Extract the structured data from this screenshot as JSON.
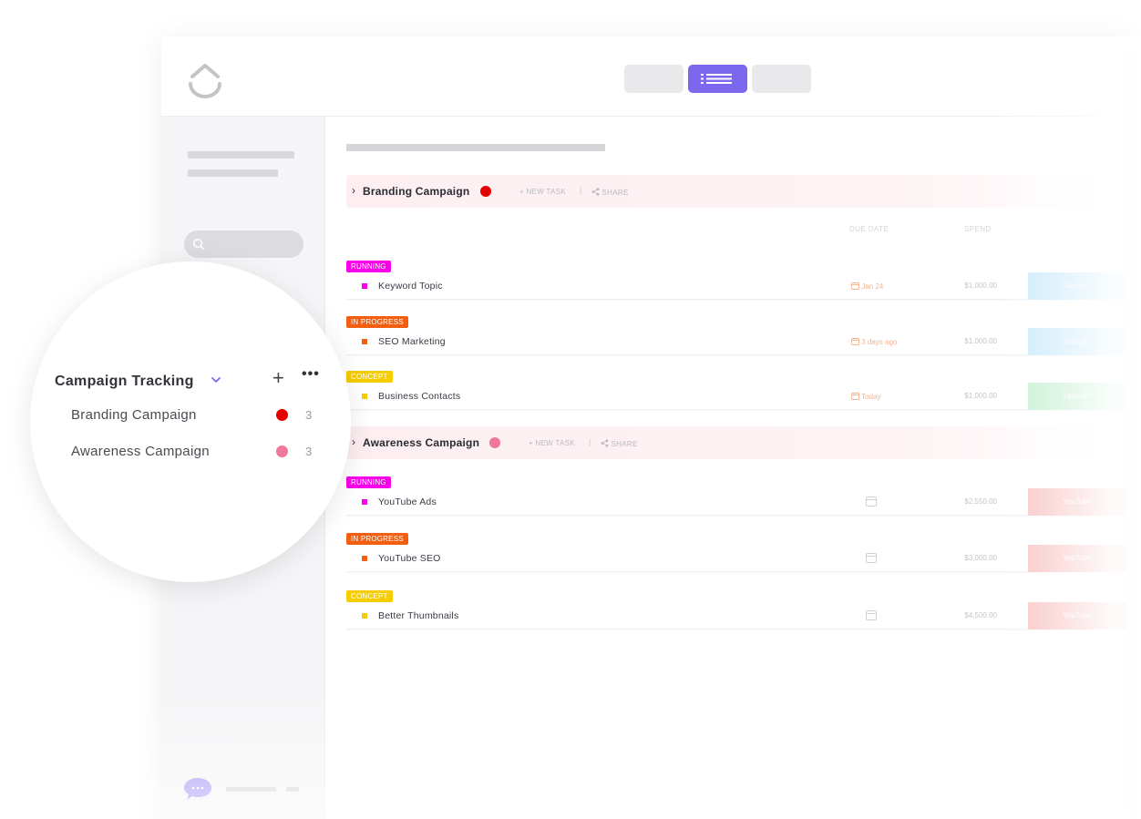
{
  "colors": {
    "accent": "#7b68ee",
    "running": "#f900ea",
    "in_progress": "#f25f10",
    "concept": "#f5cd00",
    "branding_dot": "#e50000",
    "awareness_dot": "#f0789b",
    "google_tag": "#bfe4fb",
    "linkedin_tag": "#b9ecc9",
    "youtube_tag": "#f7b7b7"
  },
  "icons": [
    "clickup-logo-icon",
    "list-view-icon",
    "search-icon",
    "chevron-right-icon",
    "share-icon",
    "calendar-icon",
    "chat-bubble-icon",
    "plus-icon",
    "more-icon",
    "chevron-down-icon"
  ],
  "groups": [
    {
      "name": "Branding Campaign",
      "new_task": "+ NEW TASK",
      "share": "SHARE",
      "columns": {
        "due_date": "DUE DATE",
        "spend": "SPEND"
      },
      "tasks": [
        {
          "status": "RUNNING",
          "name": "Keyword Topic",
          "due": "Jan 24",
          "spend": "$1,000.00",
          "tag": "Google"
        },
        {
          "status": "IN PROGRESS",
          "name": "SEO Marketing",
          "due": "3 days ago",
          "spend": "$1,000.00",
          "tag": "Google"
        },
        {
          "status": "CONCEPT",
          "name": "Business Contacts",
          "due": "Today",
          "spend": "$1,000.00",
          "tag": "LinkedIn"
        }
      ]
    },
    {
      "name": "Awareness Campaign",
      "new_task": "+ NEW TASK",
      "share": "SHARE",
      "tasks": [
        {
          "status": "RUNNING",
          "name": "YouTube Ads",
          "spend": "$2,550.00",
          "tag": "YouTube"
        },
        {
          "status": "IN PROGRESS",
          "name": "YouTube SEO",
          "spend": "$3,000.00",
          "tag": "YouTube"
        },
        {
          "status": "CONCEPT",
          "name": "Better Thumbnails",
          "spend": "$4,500.00",
          "tag": "YouTube"
        }
      ]
    }
  ],
  "zoom_panel": {
    "title": "Campaign Tracking",
    "items": [
      {
        "label": "Branding Campaign",
        "count": "3"
      },
      {
        "label": "Awareness Campaign",
        "count": "3"
      }
    ]
  }
}
